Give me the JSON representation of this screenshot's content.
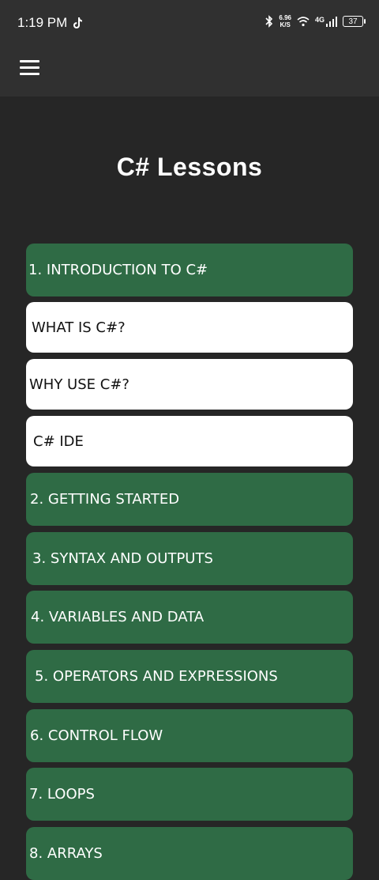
{
  "status_bar": {
    "time": "1:19 PM",
    "net_speed_value": "6.96",
    "net_speed_unit": "K/S",
    "network_type": "4G",
    "battery": "37"
  },
  "header": {
    "title": "C#  Lessons"
  },
  "lessons": [
    {
      "label": "1. INTRODUCTION TO C#",
      "style": "section"
    },
    {
      "label": "WHAT IS C#?",
      "style": "subitem"
    },
    {
      "label": "WHY USE C#?",
      "style": "subitem"
    },
    {
      "label": "C# IDE",
      "style": "subitem"
    },
    {
      "label": "2. GETTING STARTED",
      "style": "section"
    },
    {
      "label": "3. SYNTAX AND OUTPUTS",
      "style": "section"
    },
    {
      "label": "4. VARIABLES AND DATA",
      "style": "section"
    },
    {
      "label": "5. OPERATORS AND EXPRESSIONS",
      "style": "section"
    },
    {
      "label": "6. CONTROL FLOW",
      "style": "section"
    },
    {
      "label": "7. LOOPS",
      "style": "section"
    },
    {
      "label": "8. ARRAYS",
      "style": "section"
    }
  ],
  "colors": {
    "background": "#262626",
    "bar": "#303030",
    "section": "#2f6b45",
    "subitem": "#ffffff"
  }
}
